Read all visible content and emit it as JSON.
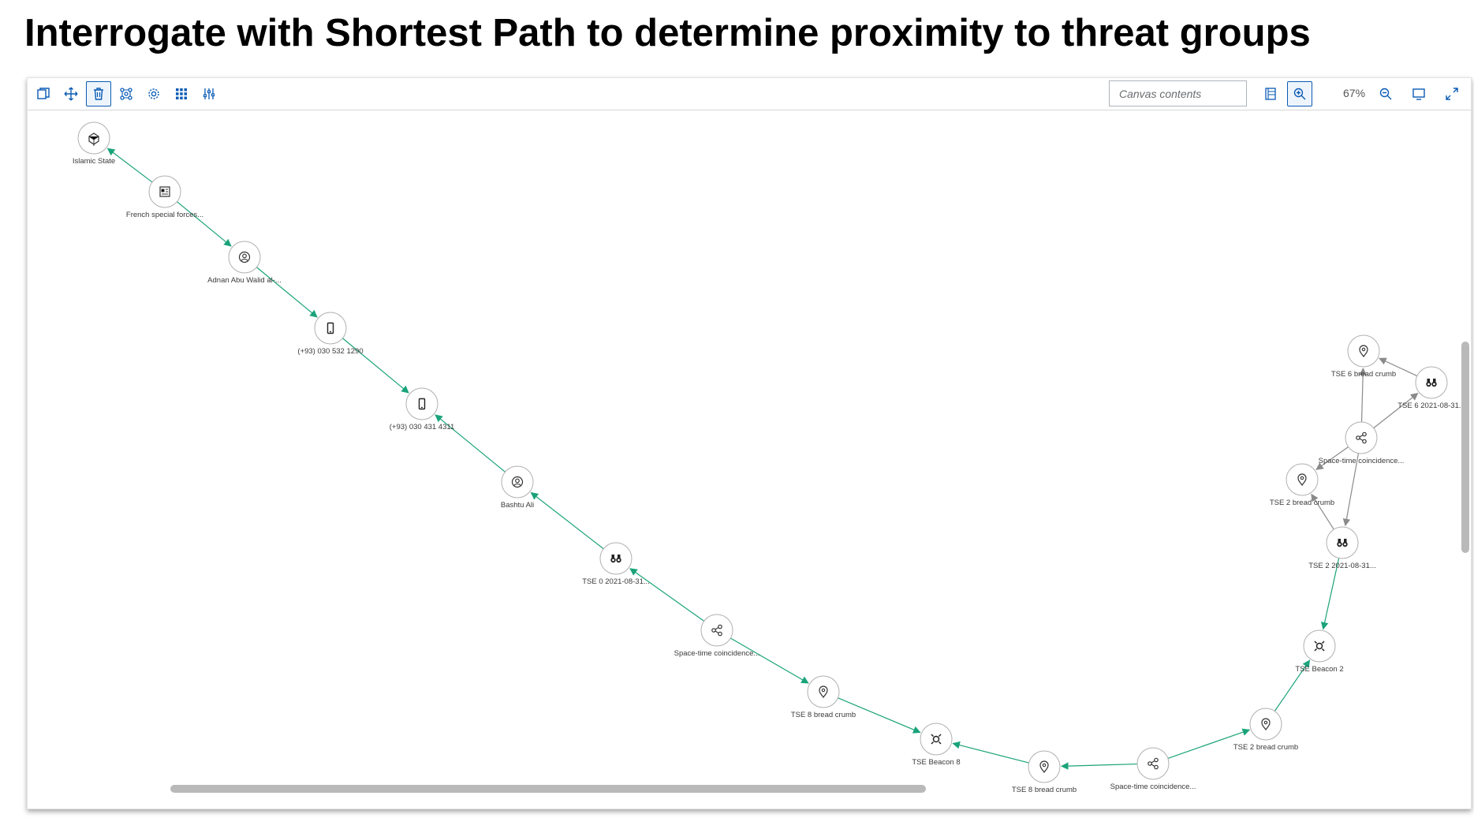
{
  "title": "Interrogate with Shortest Path to determine proximity to threat groups",
  "toolbar": {
    "left_buttons": [
      {
        "name": "copy-button",
        "icon": "copy-icon",
        "active": false
      },
      {
        "name": "move-button",
        "icon": "move-icon",
        "active": false
      },
      {
        "name": "delete-button",
        "icon": "trash-icon",
        "active": true
      },
      {
        "name": "layout-button",
        "icon": "network-layout-icon",
        "active": false
      },
      {
        "name": "settings-button",
        "icon": "gear-icon",
        "active": false
      },
      {
        "name": "grid-button",
        "icon": "grid-icon",
        "active": false
      },
      {
        "name": "filters-button",
        "icon": "sliders-icon",
        "active": false
      }
    ],
    "search_placeholder": "Canvas contents",
    "zoom_level": "67%",
    "right_buttons": [
      {
        "name": "list-view-button",
        "icon": "list-icon"
      },
      {
        "name": "zoom-in-button",
        "icon": "zoom-in-icon",
        "active": true
      },
      {
        "name": "zoom-out-button",
        "icon": "zoom-out-icon"
      },
      {
        "name": "monitor-button",
        "icon": "monitor-icon"
      },
      {
        "name": "fullscreen-button",
        "icon": "expand-icon"
      }
    ]
  },
  "colors": {
    "path_edge": "#1aa37a",
    "other_edge": "#8a8a8a",
    "node_border": "#b0b0b0",
    "accent": "#0a5bb5"
  },
  "graph": {
    "nodes": [
      {
        "id": "n1",
        "label": "Islamic State",
        "icon": "organization-icon"
      },
      {
        "id": "n2",
        "label": "French special forces...",
        "icon": "report-icon"
      },
      {
        "id": "n3",
        "label": "Adnan Abu Walid al-...",
        "icon": "person-icon"
      },
      {
        "id": "n4",
        "label": "(+93) 030 532 1290",
        "icon": "phone-icon"
      },
      {
        "id": "n5",
        "label": "(+93) 030 431 4311",
        "icon": "phone-icon"
      },
      {
        "id": "n6",
        "label": "Bashtu Ali",
        "icon": "person-icon"
      },
      {
        "id": "n7",
        "label": "TSE 0 2021-08-31...",
        "icon": "binoculars-icon"
      },
      {
        "id": "n8",
        "label": "Space-time coincidence...",
        "icon": "share-icon"
      },
      {
        "id": "n9",
        "label": "TSE 8 bread crumb",
        "icon": "location-pin-icon"
      },
      {
        "id": "n10",
        "label": "TSE Beacon 8",
        "icon": "beacon-icon"
      },
      {
        "id": "n11",
        "label": "TSE 8 bread crumb",
        "icon": "location-pin-icon"
      },
      {
        "id": "n12",
        "label": "Space-time coincidence...",
        "icon": "share-icon"
      },
      {
        "id": "n13",
        "label": "TSE 2 bread crumb",
        "icon": "location-pin-icon"
      },
      {
        "id": "n14",
        "label": "TSE Beacon 2",
        "icon": "beacon-icon"
      },
      {
        "id": "n15",
        "label": "TSE 2 2021-08-31...",
        "icon": "binoculars-icon"
      },
      {
        "id": "n16",
        "label": "TSE 2 bread crumb",
        "icon": "location-pin-icon"
      },
      {
        "id": "n17",
        "label": "Space-time coincidence...",
        "icon": "share-icon"
      },
      {
        "id": "n18",
        "label": "TSE 6 bread crumb",
        "icon": "location-pin-icon"
      },
      {
        "id": "n19",
        "label": "TSE 6 2021-08-31...",
        "icon": "binoculars-icon"
      }
    ],
    "edges": [
      {
        "from": "n2",
        "to": "n1",
        "path": true
      },
      {
        "from": "n2",
        "to": "n3",
        "path": true
      },
      {
        "from": "n3",
        "to": "n4",
        "path": true
      },
      {
        "from": "n4",
        "to": "n5",
        "path": true
      },
      {
        "from": "n6",
        "to": "n5",
        "path": true
      },
      {
        "from": "n7",
        "to": "n6",
        "path": true
      },
      {
        "from": "n8",
        "to": "n7",
        "path": true
      },
      {
        "from": "n8",
        "to": "n9",
        "path": true
      },
      {
        "from": "n9",
        "to": "n10",
        "path": true
      },
      {
        "from": "n11",
        "to": "n10",
        "path": true
      },
      {
        "from": "n12",
        "to": "n11",
        "path": true
      },
      {
        "from": "n12",
        "to": "n13",
        "path": true
      },
      {
        "from": "n13",
        "to": "n14",
        "path": true
      },
      {
        "from": "n15",
        "to": "n14",
        "path": true
      },
      {
        "from": "n15",
        "to": "n16",
        "path": false
      },
      {
        "from": "n17",
        "to": "n16",
        "path": false
      },
      {
        "from": "n17",
        "to": "n15",
        "path": false
      },
      {
        "from": "n17",
        "to": "n18",
        "path": false
      },
      {
        "from": "n17",
        "to": "n19",
        "path": false
      },
      {
        "from": "n19",
        "to": "n18",
        "path": false
      }
    ]
  }
}
